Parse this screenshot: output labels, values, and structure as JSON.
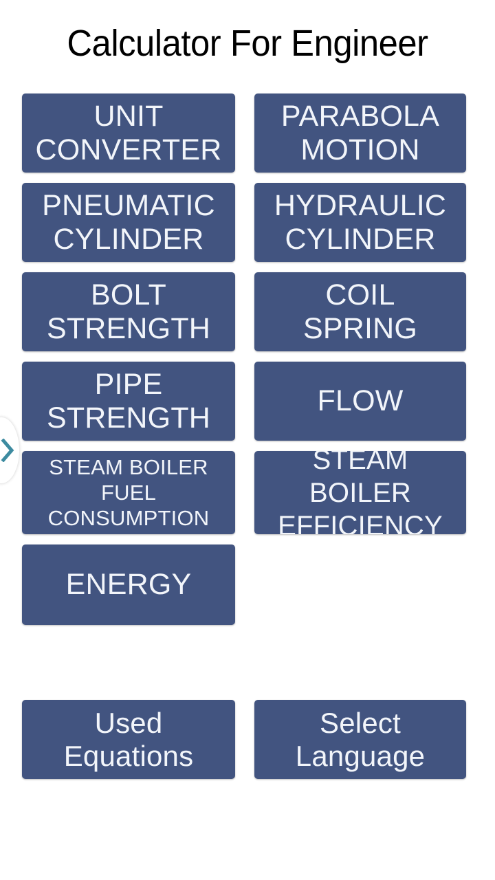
{
  "app": {
    "title": "Calculator For Engineer",
    "background_color": "#ffffff",
    "button_color": "#425480",
    "button_text_color": "#f2f5fa",
    "accent_color": "#3d8ba0"
  },
  "menu": {
    "rows": [
      {
        "left": {
          "label": "UNIT\nCONVERTER",
          "name": "unit-converter"
        },
        "right": {
          "label": "PARABOLA\nMOTION",
          "name": "parabola-motion"
        }
      },
      {
        "left": {
          "label": "PNEUMATIC\nCYLINDER",
          "name": "pneumatic-cylinder"
        },
        "right": {
          "label": "HYDRAULIC\nCYLINDER",
          "name": "hydraulic-cylinder"
        }
      },
      {
        "left": {
          "label": "BOLT\nSTRENGTH",
          "name": "bolt-strength"
        },
        "right": {
          "label": "COIL\nSPRING",
          "name": "coil-spring"
        }
      },
      {
        "left": {
          "label": "PIPE\nSTRENGTH",
          "name": "pipe-strength"
        },
        "right": {
          "label": "FLOW",
          "name": "flow"
        }
      },
      {
        "left": {
          "label": "STEAM BOILER\nFUEL\nCONSUMPTION",
          "name": "steam-boiler-fuel-consumption"
        },
        "right": {
          "label": "STEAM BOILER\nEFFICIENCY",
          "name": "steam-boiler-efficiency"
        }
      },
      {
        "left": {
          "label": "ENERGY",
          "name": "energy"
        },
        "right": null
      }
    ]
  },
  "bottom": {
    "used_equations": "Used\nEquations",
    "select_language": "Select\nLanguage"
  },
  "drawer": {
    "handle_icon": "chevron-right-icon"
  }
}
